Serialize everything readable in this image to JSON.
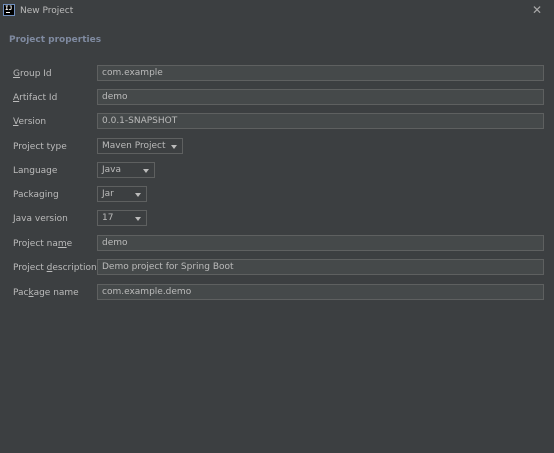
{
  "window": {
    "title": "New Project",
    "icon_text": "IJ",
    "close_glyph": "✕"
  },
  "section": {
    "header": "Project properties"
  },
  "fields": {
    "group_id": {
      "label_mnemonic": "G",
      "label_rest": "roup Id",
      "value": "com.example"
    },
    "artifact_id": {
      "label_mnemonic": "A",
      "label_rest": "rtifact Id",
      "value": "demo"
    },
    "version": {
      "label_mnemonic": "V",
      "label_rest": "ersion",
      "value": "0.0.1-SNAPSHOT"
    },
    "project_type": {
      "label": "Project type",
      "value": "Maven Project"
    },
    "language": {
      "label": "Language",
      "value": "Java"
    },
    "packaging": {
      "label": "Packaging",
      "value": "Jar"
    },
    "java_version": {
      "label": "Java version",
      "value": "17"
    },
    "project_name": {
      "label_pre": "Project na",
      "label_mnemonic": "m",
      "label_rest": "e",
      "value": "demo"
    },
    "project_description": {
      "label_pre": "Project ",
      "label_mnemonic": "d",
      "label_rest": "escription",
      "value": "Demo project for Spring Boot"
    },
    "package_name": {
      "label_pre": "Pac",
      "label_mnemonic": "k",
      "label_rest": "age name",
      "value": "com.example.demo"
    }
  },
  "icons": {
    "app": "intellij-icon",
    "close": "close-icon",
    "dropdown": "chevron-down-icon"
  },
  "colors": {
    "background": "#3c3f41",
    "field_background": "#45494a",
    "field_border": "#5e6060",
    "text": "#bbbbbb",
    "section_header": "#7f8aa0"
  }
}
